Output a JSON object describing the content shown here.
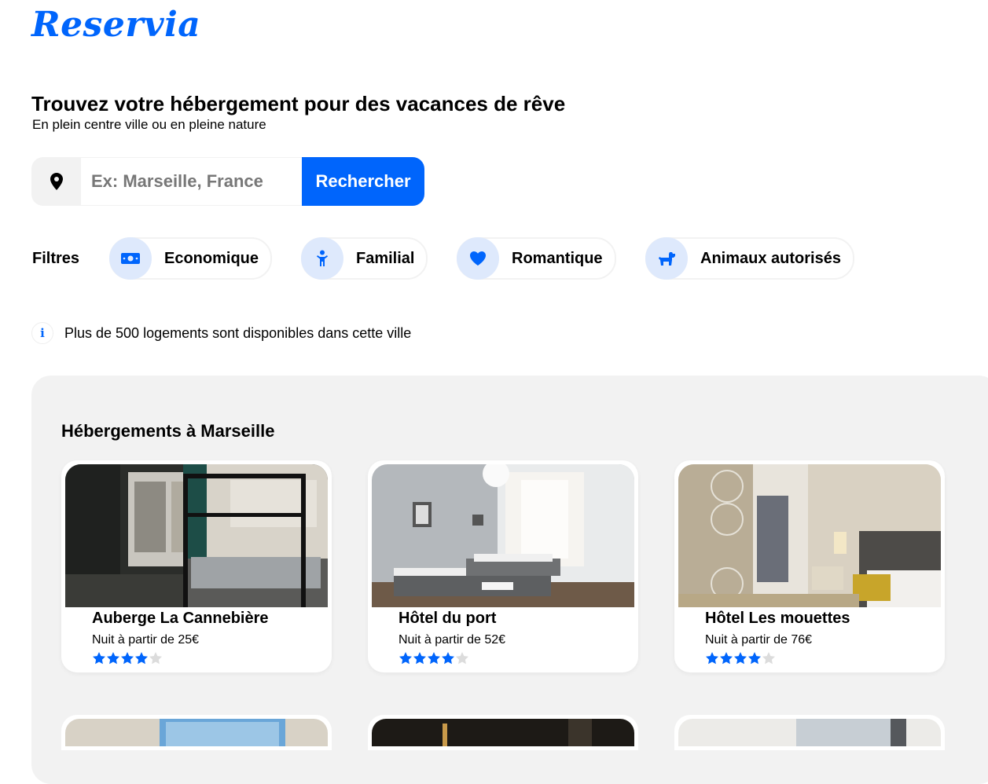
{
  "brand": {
    "logo": "Reservia",
    "accent": "#0065fc"
  },
  "hero": {
    "title": "Trouvez votre hébergement pour des vacances de rêve",
    "subtitle": "En plein centre ville ou en pleine nature"
  },
  "search": {
    "icon": "location-pin-icon",
    "placeholder": "Ex: Marseille, France",
    "value": "",
    "button_label": "Rechercher"
  },
  "filters": {
    "label": "Filtres",
    "items": [
      {
        "label": "Economique",
        "icon": "money-icon"
      },
      {
        "label": "Familial",
        "icon": "child-icon"
      },
      {
        "label": "Romantique",
        "icon": "heart-icon"
      },
      {
        "label": "Animaux autorisés",
        "icon": "dog-icon"
      }
    ]
  },
  "info": {
    "icon": "info-icon",
    "text": "Plus de 500 logements sont disponibles dans cette ville"
  },
  "listing": {
    "title": "Hébergements à Marseille",
    "cards": [
      {
        "name": "Auberge La Cannebière",
        "price": "Nuit à partir de 25€",
        "rating": 4,
        "max_rating": 5
      },
      {
        "name": "Hôtel du port",
        "price": "Nuit à partir de 52€",
        "rating": 4,
        "max_rating": 5
      },
      {
        "name": "Hôtel Les mouettes",
        "price": "Nuit à partir de 76€",
        "rating": 4,
        "max_rating": 5
      }
    ]
  }
}
